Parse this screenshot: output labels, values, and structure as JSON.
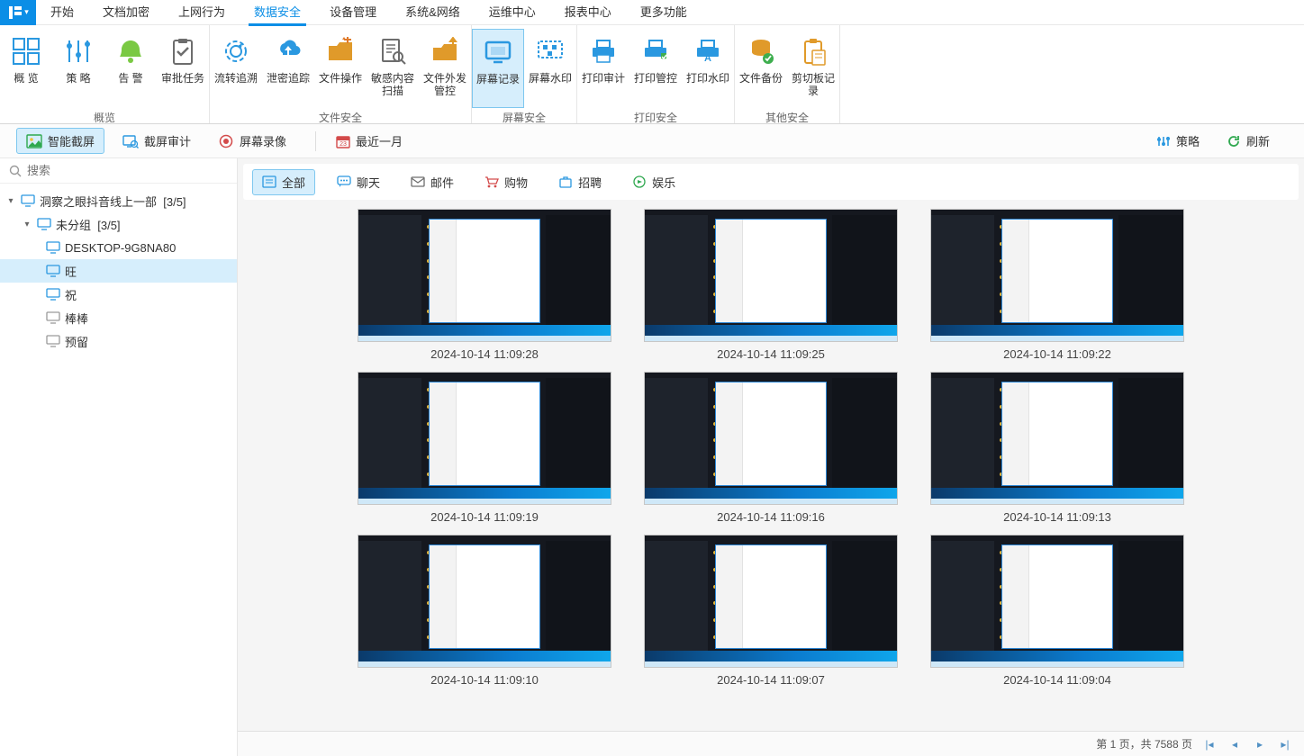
{
  "menubar": {
    "items": [
      "开始",
      "文档加密",
      "上网行为",
      "数据安全",
      "设备管理",
      "系统&网络",
      "运维中心",
      "报表中心",
      "更多功能"
    ],
    "active_index": 3
  },
  "ribbon": {
    "groups": [
      {
        "label": "概览",
        "items": [
          {
            "name": "overview",
            "label": "概  览",
            "color": "#2a98e0"
          },
          {
            "name": "strategy",
            "label": "策  略",
            "color": "#2a98e0"
          },
          {
            "name": "warning",
            "label": "告  警",
            "color": "#7ac943"
          },
          {
            "name": "approval",
            "label": "审批任务",
            "color": "#6d6d6d"
          }
        ]
      },
      {
        "label": "文件安全",
        "items": [
          {
            "name": "trace",
            "label": "流转追溯",
            "color": "#2a98e0"
          },
          {
            "name": "leak-trace",
            "label": "泄密追踪",
            "color": "#2a98e0"
          },
          {
            "name": "file-op",
            "label": "文件操作",
            "color": "#e09a2a"
          },
          {
            "name": "sensitive-scan",
            "label": "敏感内容扫描",
            "color": "#6d6d6d"
          },
          {
            "name": "outgoing",
            "label": "文件外发管控",
            "color": "#e09a2a"
          }
        ]
      },
      {
        "label": "屏幕安全",
        "items": [
          {
            "name": "screen-record",
            "label": "屏幕记录",
            "color": "#2a98e0",
            "active": true
          },
          {
            "name": "screen-watermark",
            "label": "屏幕水印",
            "color": "#2a98e0"
          }
        ]
      },
      {
        "label": "打印安全",
        "items": [
          {
            "name": "print-audit",
            "label": "打印审计",
            "color": "#2a98e0"
          },
          {
            "name": "print-control",
            "label": "打印管控",
            "color": "#2a98e0"
          },
          {
            "name": "print-watermark",
            "label": "打印水印",
            "color": "#2a98e0"
          }
        ]
      },
      {
        "label": "其他安全",
        "items": [
          {
            "name": "file-backup",
            "label": "文件备份",
            "color": "#e09a2a"
          },
          {
            "name": "clipboard-record",
            "label": "剪切板记录",
            "color": "#e09a2a"
          }
        ]
      }
    ]
  },
  "toolbar2": {
    "tabs": [
      {
        "name": "smart-capture",
        "label": "智能截屏",
        "active": true
      },
      {
        "name": "capture-audit",
        "label": "截屏审计"
      },
      {
        "name": "screen-video",
        "label": "屏幕录像"
      }
    ],
    "range": {
      "label": "最近一月"
    },
    "right": {
      "strategy": "策略",
      "refresh": "刷新"
    }
  },
  "search": {
    "placeholder": "搜索"
  },
  "tree": {
    "root": {
      "label": "洞察之眼抖音线上一部",
      "count": "[3/5]"
    },
    "group": {
      "label": "未分组",
      "count": "[3/5]"
    },
    "nodes": [
      {
        "name": "desktop",
        "label": "DESKTOP-9G8NA80",
        "online": true
      },
      {
        "name": "wang",
        "label": "旺",
        "online": true,
        "selected": true
      },
      {
        "name": "zhu",
        "label": "祝",
        "online": true
      },
      {
        "name": "bangbang",
        "label": "棒棒",
        "online": false
      },
      {
        "name": "yuliu",
        "label": "预留",
        "online": false
      }
    ]
  },
  "filters": {
    "items": [
      {
        "name": "all",
        "label": "全部",
        "active": true
      },
      {
        "name": "chat",
        "label": "聊天"
      },
      {
        "name": "mail",
        "label": "邮件"
      },
      {
        "name": "shopping",
        "label": "购物"
      },
      {
        "name": "recruit",
        "label": "招聘"
      },
      {
        "name": "entertain",
        "label": "娱乐"
      }
    ]
  },
  "thumbnails": [
    {
      "ts": "2024-10-14 11:09:28"
    },
    {
      "ts": "2024-10-14 11:09:25"
    },
    {
      "ts": "2024-10-14 11:09:22"
    },
    {
      "ts": "2024-10-14 11:09:19"
    },
    {
      "ts": "2024-10-14 11:09:16"
    },
    {
      "ts": "2024-10-14 11:09:13"
    },
    {
      "ts": "2024-10-14 11:09:10"
    },
    {
      "ts": "2024-10-14 11:09:07"
    },
    {
      "ts": "2024-10-14 11:09:04"
    }
  ],
  "pager": {
    "text": "第 1 页，共 7588 页"
  }
}
